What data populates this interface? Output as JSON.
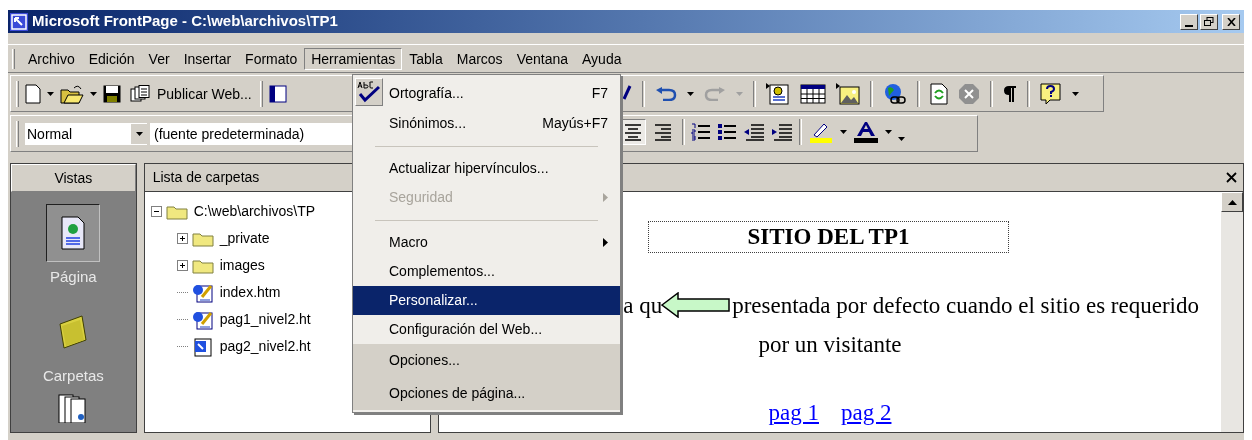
{
  "window": {
    "title": "Microsoft FrontPage - C:\\web\\archivos\\TP1"
  },
  "menu_bar": [
    {
      "label": "Archivo",
      "selected": false
    },
    {
      "label": "Edición",
      "selected": false
    },
    {
      "label": "Ver",
      "selected": false
    },
    {
      "label": "Insertar",
      "selected": false
    },
    {
      "label": "Formato",
      "selected": false
    },
    {
      "label": "Herramientas",
      "selected": true
    },
    {
      "label": "Tabla",
      "selected": false
    },
    {
      "label": "Marcos",
      "selected": false
    },
    {
      "label": "Ventana",
      "selected": false
    },
    {
      "label": "Ayuda",
      "selected": false
    }
  ],
  "standard_toolbar": {
    "publish_label": "Publicar Web..."
  },
  "format_toolbar": {
    "style": "Normal",
    "font": "(fuente predeterminada)",
    "align": [
      {
        "kind": "center",
        "pressed": true
      },
      {
        "kind": "right",
        "pressed": false
      }
    ]
  },
  "tools_menu": [
    {
      "kind": "spellcheck",
      "label": "Ortografía...",
      "shortcut": "F7",
      "disabled": false,
      "submenu": false,
      "selected": false,
      "recent": true
    },
    {
      "kind": "item",
      "label": "Sinónimos...",
      "shortcut": "Mayús+F7",
      "disabled": false,
      "submenu": false,
      "selected": false,
      "recent": true
    },
    {
      "kind": "separator"
    },
    {
      "kind": "item",
      "label": "Actualizar hipervínculos...",
      "disabled": false,
      "submenu": false,
      "selected": false,
      "recent": true
    },
    {
      "kind": "item",
      "label": "Seguridad",
      "disabled": true,
      "submenu": true,
      "selected": false,
      "recent": true
    },
    {
      "kind": "separator"
    },
    {
      "kind": "item",
      "label": "Macro",
      "disabled": false,
      "submenu": true,
      "selected": false,
      "recent": true
    },
    {
      "kind": "item",
      "label": "Complementos...",
      "disabled": false,
      "submenu": false,
      "selected": false,
      "recent": true
    },
    {
      "kind": "item",
      "label": "Personalizar...",
      "disabled": false,
      "submenu": false,
      "selected": true,
      "recent": true
    },
    {
      "kind": "item",
      "label": "Configuración del Web...",
      "disabled": false,
      "submenu": false,
      "selected": false,
      "recent": true
    },
    {
      "kind": "item",
      "label": "Opciones...",
      "disabled": false,
      "submenu": false,
      "selected": false,
      "recent": false
    },
    {
      "kind": "item",
      "label": "Opciones de página...",
      "disabled": false,
      "submenu": false,
      "selected": false,
      "recent": false
    }
  ],
  "views_panel": {
    "title": "Vistas",
    "items": [
      {
        "label": "Página",
        "kind": "page",
        "selected": true
      },
      {
        "label": "Carpetas",
        "kind": "folders",
        "selected": false
      }
    ]
  },
  "folder_list": {
    "title": "Lista de carpetas",
    "tree": [
      {
        "label": "C:\\web\\archivos\\TP",
        "kind": "folder",
        "expanded": true,
        "children": [
          {
            "label": "_private",
            "kind": "folder",
            "expanded": false
          },
          {
            "label": "images",
            "kind": "folder",
            "expanded": false
          },
          {
            "label": "index.htm",
            "kind": "page-edit"
          },
          {
            "label": "pag1_nivel2.ht",
            "kind": "page-edit"
          },
          {
            "label": "pag2_nivel2.ht",
            "kind": "page"
          }
        ]
      }
    ]
  },
  "editor": {
    "heading": "SITIO DEL TP1",
    "line_1": [
      "a qu",
      "presentada por defecto cuando el sitio es requerido"
    ],
    "line_2": "por un visitante",
    "links": [
      "pag 1",
      "pag 2"
    ]
  }
}
